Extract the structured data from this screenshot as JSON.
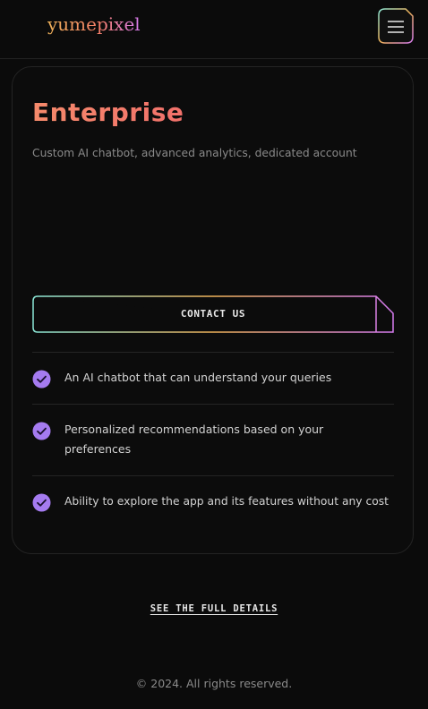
{
  "header": {
    "logo": "yumepixel",
    "menu_icon": "hamburger-menu-icon"
  },
  "plan": {
    "title": "Enterprise",
    "description": "Custom AI chatbot, advanced analytics, dedicated account",
    "cta_label": "CONTACT US",
    "features": [
      {
        "icon": "check-circle-icon",
        "text": "An AI chatbot that can understand your queries"
      },
      {
        "icon": "check-circle-icon",
        "text": "Personalized recommendations based on your preferences"
      },
      {
        "icon": "check-circle-icon",
        "text": "Ability to explore the app and its features without any cost"
      }
    ]
  },
  "details_link": "SEE THE FULL DETAILS",
  "footer": {
    "copyright": "© 2024. All rights reserved."
  },
  "colors": {
    "background": "#0b0b0b",
    "title_gradient_start": "#f58a6b",
    "check_fill": "#a57bf0",
    "border_gradient": [
      "#8be8d8",
      "#f0b35a",
      "#d67bf0"
    ]
  }
}
